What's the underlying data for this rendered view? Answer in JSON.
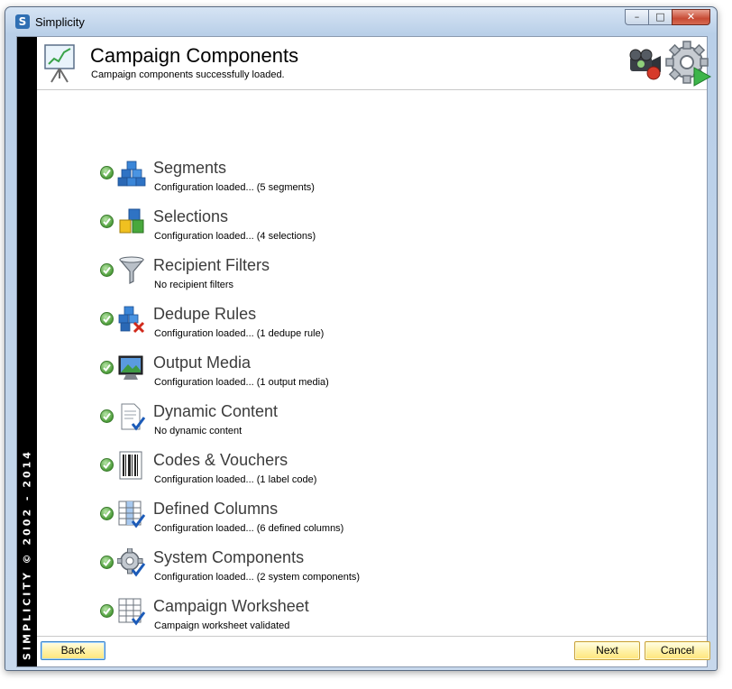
{
  "window": {
    "title": "Simplicity",
    "app_icon_letter": "S"
  },
  "sidebar": {
    "copyright": "SIMPLICITY © 2002 - 2014"
  },
  "header": {
    "title": "Campaign Components",
    "subtitle": "Campaign components successfully loaded."
  },
  "components": [
    {
      "title": "Segments",
      "status": "Configuration loaded... (5 segments)",
      "icon": "cubes-icon"
    },
    {
      "title": "Selections",
      "status": "Configuration loaded... (4 selections)",
      "icon": "colored-cubes-icon"
    },
    {
      "title": "Recipient Filters",
      "status": "No recipient filters",
      "icon": "funnel-icon"
    },
    {
      "title": "Dedupe Rules",
      "status": "Configuration loaded... (1 dedupe rule)",
      "icon": "cubes-delete-icon"
    },
    {
      "title": "Output Media",
      "status": "Configuration loaded... (1 output media)",
      "icon": "monitor-icon"
    },
    {
      "title": "Dynamic Content",
      "status": "No dynamic content",
      "icon": "document-check-icon"
    },
    {
      "title": "Codes & Vouchers",
      "status": "Configuration loaded... (1 label code)",
      "icon": "barcode-icon"
    },
    {
      "title": "Defined Columns",
      "status": "Configuration loaded... (6 defined columns)",
      "icon": "columns-check-icon"
    },
    {
      "title": "System Components",
      "status": "Configuration loaded... (2 system components)",
      "icon": "gear-check-icon"
    },
    {
      "title": "Campaign Worksheet",
      "status": "Campaign worksheet validated",
      "icon": "grid-check-icon"
    }
  ],
  "footer": {
    "back_label": "Back",
    "next_label": "Next",
    "cancel_label": "Cancel"
  },
  "colors": {
    "sidebar": "#000000",
    "check_green": "#4d9d3a",
    "button_yellow": "#ffe57a",
    "title_text": "#3c3c3c"
  }
}
